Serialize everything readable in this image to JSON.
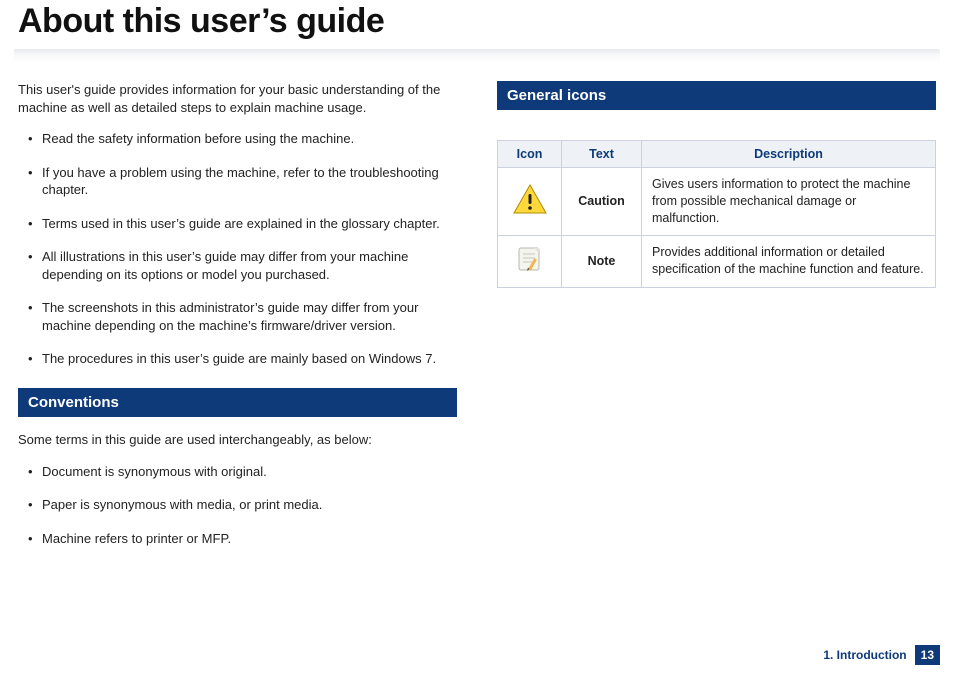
{
  "title": "About this user’s guide",
  "intro": "This user's guide provides information for your basic understanding of the machine as well as detailed steps to explain machine usage.",
  "bullets": [
    "Read the safety information before using the machine.",
    "If you have a problem using the machine, refer to the troubleshooting chapter.",
    "Terms used in this user’s guide are explained in the glossary chapter.",
    "All illustrations in this user’s guide may differ from your machine depending on its options or model you purchased.",
    "The screenshots in this administrator’s guide may differ from your machine depending on the machine’s firmware/driver version.",
    "The procedures in this user’s guide are mainly based on Windows 7."
  ],
  "sections": {
    "conventions": {
      "heading": "Conventions",
      "sub": "Some terms in this guide are used interchangeably, as below:",
      "items": [
        "Document is synonymous with original.",
        "Paper is synonymous with media, or print media.",
        "Machine refers to printer or MFP."
      ]
    },
    "general_icons": {
      "heading": "General icons",
      "table": {
        "headers": {
          "icon": "Icon",
          "text": "Text",
          "desc": "Description"
        },
        "rows": [
          {
            "text": "Caution",
            "desc": "Gives users information to protect the machine from possible mechanical damage or malfunction."
          },
          {
            "text": "Note",
            "desc": "Provides additional information or detailed specification of the machine function and feature."
          }
        ]
      }
    }
  },
  "footer": {
    "chapter": "1. Introduction",
    "page": "13"
  }
}
